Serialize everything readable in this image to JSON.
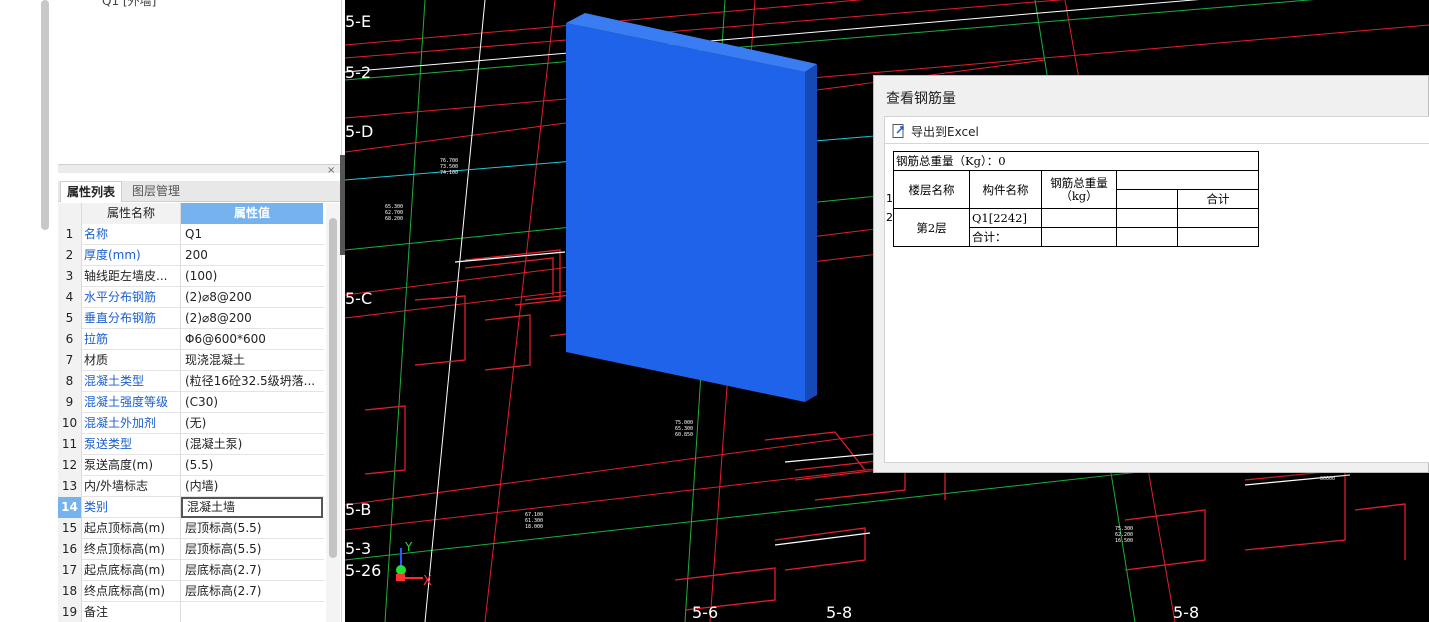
{
  "tree": {
    "item": "Q1 [外墙]"
  },
  "panel": {
    "close": "×"
  },
  "tabs": [
    {
      "label": "属性列表"
    },
    {
      "label": "图层管理"
    }
  ],
  "grid": {
    "header_name": "属性名称",
    "header_value": "属性值",
    "rows": [
      {
        "num": "1",
        "name": "名称",
        "value": "Q1"
      },
      {
        "num": "2",
        "name": "厚度(mm)",
        "value": "200"
      },
      {
        "num": "3",
        "name": "轴线距左墙皮...",
        "value": "(100)"
      },
      {
        "num": "4",
        "name": "水平分布钢筋",
        "value": "(2)⌀8@200"
      },
      {
        "num": "5",
        "name": "垂直分布钢筋",
        "value": "(2)⌀8@200"
      },
      {
        "num": "6",
        "name": "拉筋",
        "value": "Φ6@600*600"
      },
      {
        "num": "7",
        "name": "材质",
        "value": "现浇混凝土"
      },
      {
        "num": "8",
        "name": "混凝土类型",
        "value": "(粒径16砼32.5级坍落..."
      },
      {
        "num": "9",
        "name": "混凝土强度等级",
        "value": "(C30)"
      },
      {
        "num": "10",
        "name": "混凝土外加剂",
        "value": "(无)"
      },
      {
        "num": "11",
        "name": "泵送类型",
        "value": "(混凝土泵)"
      },
      {
        "num": "12",
        "name": "泵送高度(m)",
        "value": "(5.5)"
      },
      {
        "num": "13",
        "name": "内/外墙标志",
        "value": "(内墙)"
      },
      {
        "num": "14",
        "name": "类别",
        "value": "混凝土墙"
      },
      {
        "num": "15",
        "name": "起点顶标高(m)",
        "value": "层顶标高(5.5)"
      },
      {
        "num": "16",
        "name": "终点顶标高(m)",
        "value": "层顶标高(5.5)"
      },
      {
        "num": "17",
        "name": "起点底标高(m)",
        "value": "层底标高(2.7)"
      },
      {
        "num": "18",
        "name": "终点底标高(m)",
        "value": "层底标高(2.7)"
      },
      {
        "num": "19",
        "name": "备注",
        "value": ""
      }
    ]
  },
  "viewport": {
    "axis_labels": [
      "5-E",
      "5-2",
      "5-D",
      "5-C",
      "5-B",
      "5-3",
      "5-26",
      "5-6",
      "5-8",
      "5-8"
    ],
    "gizmo": {
      "x": "X",
      "y": "Y"
    }
  },
  "dialog": {
    "title": "查看钢筋量",
    "export_label": "导出到Excel",
    "table": {
      "total_weight": "钢筋总重量（Kg）：0",
      "col_floor": "楼层名称",
      "col_component": "构件名称",
      "col_weight": "钢筋总重量（kg）",
      "col_sum": "合计",
      "floor": "第2层",
      "component": "Q1[2242]",
      "subtotal": "合计："
    },
    "row_indices": [
      "1",
      "2"
    ]
  },
  "colors": {
    "wall": "#1e63ea",
    "grid_header": "#76b3ee",
    "link_blue": "#1a5fcf",
    "cad_red": "#e0202a",
    "cad_green": "#1fae3c"
  }
}
